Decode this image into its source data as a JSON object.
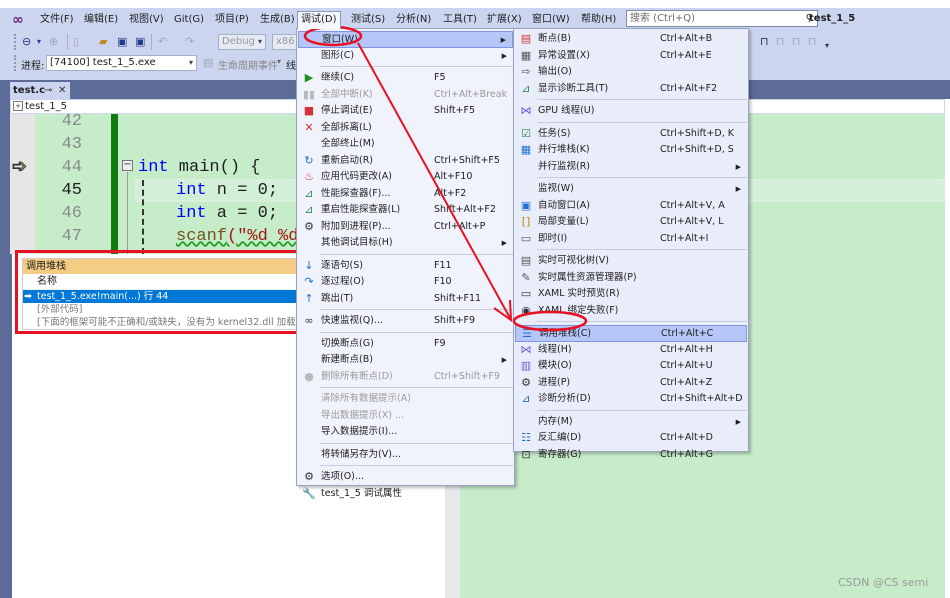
{
  "menubar": {
    "items": [
      "文件(F)",
      "编辑(E)",
      "视图(V)",
      "Git(G)",
      "项目(P)",
      "生成(B)",
      "调试(D)",
      "测试(S)",
      "分析(N)",
      "工具(T)",
      "扩展(X)",
      "窗口(W)",
      "帮助(H)"
    ],
    "open_index": 6
  },
  "search": {
    "placeholder": "搜索 (Ctrl+Q)",
    "icon": "search-icon"
  },
  "window_title": "test_1_5",
  "toolbar": {
    "config": "Debug",
    "platform": "x86",
    "process_label": "进程:",
    "process_value": "[74100] test_1_5.exe",
    "lifecycle": "生命周期事件",
    "thread_label": "线"
  },
  "doc_tab": {
    "label": "test.c",
    "pin": "⊸",
    "close": "✕"
  },
  "navbar": {
    "project": "test_1_5"
  },
  "editor": {
    "line_numbers": [
      "42",
      "43",
      "44",
      "45",
      "46",
      "47"
    ],
    "current_line": "45",
    "code": [
      {
        "kw": "int",
        "rest": " main() {"
      },
      {
        "kw": "int",
        "rest": " n = 0;"
      },
      {
        "kw": "int",
        "rest": " a = 0;"
      },
      {
        "fn": "scanf",
        "str": "(\"%d %d\""
      }
    ]
  },
  "callstack": {
    "title": "调用堆栈",
    "column": "名称",
    "rows": [
      "test_1_5.exe!main(...) 行 44",
      "[外部代码]",
      "[下面的框架可能不正确和/或缺失，没有为 kernel32.dll 加载符号]"
    ]
  },
  "debug_menu": [
    {
      "label": "窗口(W)",
      "submenu": true,
      "highlighted": true
    },
    {
      "label": "图形(C)",
      "submenu": true
    },
    {
      "sep": true
    },
    {
      "label": "继续(C)",
      "shortcut": "F5",
      "icon": "play-icon"
    },
    {
      "label": "全部中断(K)",
      "shortcut": "Ctrl+Alt+Break",
      "icon": "pause-icon",
      "disabled": true
    },
    {
      "label": "停止调试(E)",
      "shortcut": "Shift+F5",
      "icon": "stop-icon"
    },
    {
      "label": "全部拆离(L)",
      "icon": "detach-icon"
    },
    {
      "label": "全部终止(M)"
    },
    {
      "label": "重新启动(R)",
      "shortcut": "Ctrl+Shift+F5",
      "icon": "restart-icon"
    },
    {
      "label": "应用代码更改(A)",
      "shortcut": "Alt+F10",
      "icon": "hot-reload-icon"
    },
    {
      "label": "性能探查器(F)...",
      "shortcut": "Alt+F2",
      "icon": "profiler-icon"
    },
    {
      "label": "重启性能探查器(L)",
      "shortcut": "Shift+Alt+F2",
      "icon": "profiler-restart-icon"
    },
    {
      "label": "附加到进程(P)...",
      "shortcut": "Ctrl+Alt+P",
      "icon": "attach-icon"
    },
    {
      "label": "其他调试目标(H)",
      "submenu": true
    },
    {
      "sep": true
    },
    {
      "label": "逐语句(S)",
      "shortcut": "F11",
      "icon": "step-into-icon"
    },
    {
      "label": "逐过程(O)",
      "shortcut": "F10",
      "icon": "step-over-icon"
    },
    {
      "label": "跳出(T)",
      "shortcut": "Shift+F11",
      "icon": "step-out-icon"
    },
    {
      "sep": true
    },
    {
      "label": "快速监视(Q)...",
      "shortcut": "Shift+F9",
      "icon": "quickwatch-icon"
    },
    {
      "sep": true
    },
    {
      "label": "切换断点(G)",
      "shortcut": "F9"
    },
    {
      "label": "新建断点(B)",
      "submenu": true
    },
    {
      "label": "删除所有断点(D)",
      "shortcut": "Ctrl+Shift+F9",
      "icon": "delete-breakpoints-icon",
      "disabled": true
    },
    {
      "sep": true
    },
    {
      "label": "清除所有数据提示(A)",
      "disabled": true
    },
    {
      "label": "导出数据提示(X) ...",
      "disabled": true
    },
    {
      "label": "导入数据提示(I)..."
    },
    {
      "sep": true
    },
    {
      "label": "将转储另存为(V)..."
    },
    {
      "sep": true
    },
    {
      "label": "选项(O)...",
      "icon": "gear-icon"
    },
    {
      "label": "test_1_5 调试属性",
      "icon": "wrench-icon"
    }
  ],
  "window_menu": [
    {
      "label": "断点(B)",
      "shortcut": "Ctrl+Alt+B",
      "icon": "breakpoints-icon"
    },
    {
      "label": "异常设置(X)",
      "shortcut": "Ctrl+Alt+E",
      "icon": "exception-icon"
    },
    {
      "label": "输出(O)",
      "icon": "output-icon"
    },
    {
      "label": "显示诊断工具(T)",
      "shortcut": "Ctrl+Alt+F2",
      "icon": "diagnostics-icon"
    },
    {
      "sep": true
    },
    {
      "label": "GPU 线程(U)",
      "icon": "gpu-threads-icon"
    },
    {
      "sep": true
    },
    {
      "label": "任务(S)",
      "shortcut": "Ctrl+Shift+D, K",
      "icon": "tasks-icon"
    },
    {
      "label": "并行堆栈(K)",
      "shortcut": "Ctrl+Shift+D, S",
      "icon": "parallel-stacks-icon"
    },
    {
      "label": "并行监视(R)",
      "submenu": true
    },
    {
      "sep": true
    },
    {
      "label": "监视(W)",
      "submenu": true
    },
    {
      "label": "自动窗口(A)",
      "shortcut": "Ctrl+Alt+V, A",
      "icon": "autos-icon"
    },
    {
      "label": "局部变量(L)",
      "shortcut": "Ctrl+Alt+V, L",
      "icon": "locals-icon"
    },
    {
      "label": "即时(I)",
      "shortcut": "Ctrl+Alt+I",
      "icon": "immediate-icon"
    },
    {
      "sep": true
    },
    {
      "label": "实时可视化树(V)",
      "icon": "visual-tree-icon"
    },
    {
      "label": "实时属性资源管理器(P)",
      "icon": "property-explorer-icon"
    },
    {
      "label": "XAML 实时预览(R)",
      "icon": "xaml-preview-icon"
    },
    {
      "label": "XAML 绑定失败(F)",
      "icon": "xaml-binding-icon"
    },
    {
      "sep": true
    },
    {
      "label": "调用堆栈(C)",
      "shortcut": "Ctrl+Alt+C",
      "icon": "call-stack-icon",
      "highlighted": true
    },
    {
      "label": "线程(H)",
      "shortcut": "Ctrl+Alt+H",
      "icon": "threads-icon"
    },
    {
      "label": "模块(O)",
      "shortcut": "Ctrl+Alt+U",
      "icon": "modules-icon"
    },
    {
      "label": "进程(P)",
      "shortcut": "Ctrl+Alt+Z",
      "icon": "processes-icon"
    },
    {
      "label": "诊断分析(D)",
      "shortcut": "Ctrl+Shift+Alt+D",
      "icon": "diagnostic-analysis-icon"
    },
    {
      "sep": true
    },
    {
      "label": "内存(M)",
      "submenu": true
    },
    {
      "label": "反汇编(D)",
      "shortcut": "Ctrl+Alt+D",
      "icon": "disassembly-icon"
    },
    {
      "label": "寄存器(G)",
      "shortcut": "Ctrl+Alt+G",
      "icon": "registers-icon"
    }
  ],
  "watermark": "CSDN @CS semi",
  "colors": {
    "annotation": "#e81123",
    "highlight": "#b6c6f6",
    "editor_bg": "#c7ecca",
    "selection": "#0078d7",
    "callstack_title": "#f5cc84"
  }
}
